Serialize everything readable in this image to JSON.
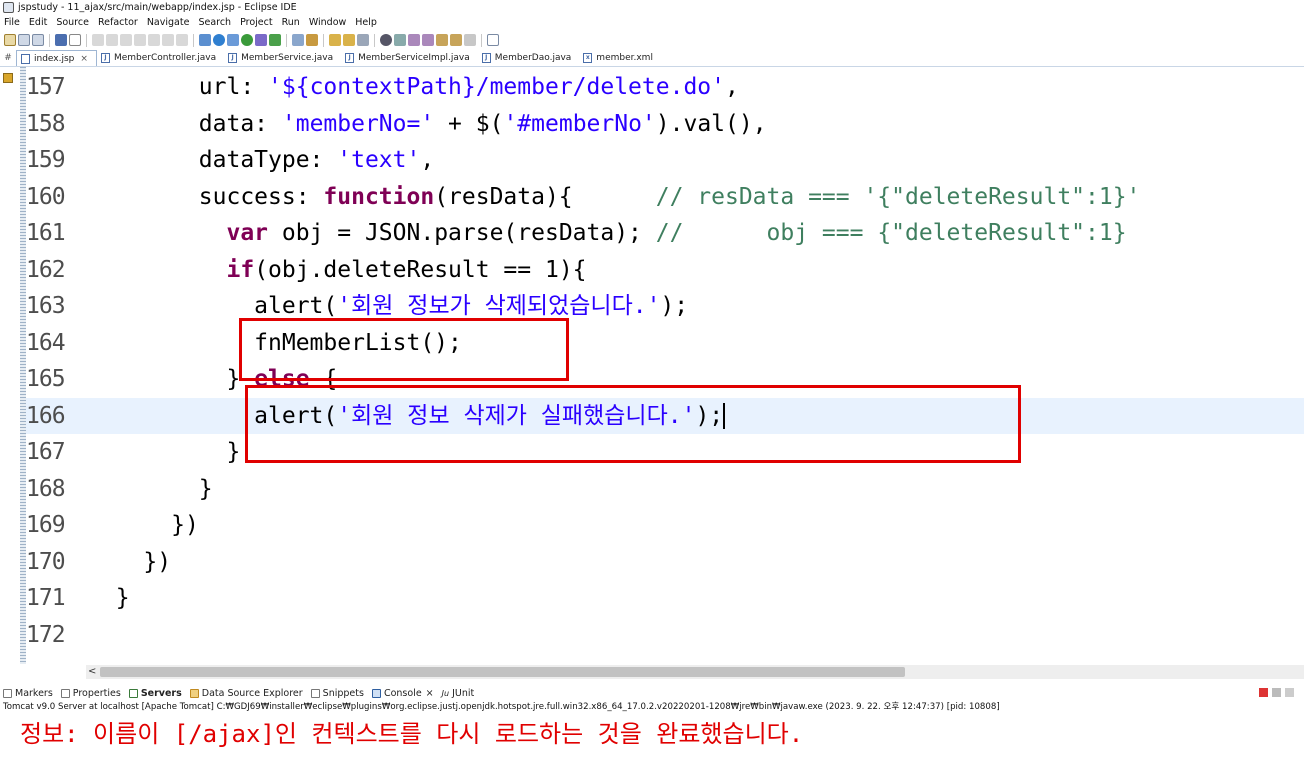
{
  "window": {
    "title": "jspstudy - 11_ajax/src/main/webapp/index.jsp - Eclipse IDE"
  },
  "menu": [
    "File",
    "Edit",
    "Source",
    "Refactor",
    "Navigate",
    "Search",
    "Project",
    "Run",
    "Window",
    "Help"
  ],
  "editor_tabs": [
    {
      "label": "index.jsp",
      "icon": "jsp-file-icon",
      "active": true,
      "close": "×"
    },
    {
      "label": "MemberController.java",
      "icon": "java-file-icon"
    },
    {
      "label": "MemberService.java",
      "icon": "java-file-icon"
    },
    {
      "label": "MemberServiceImpl.java",
      "icon": "java-file-icon"
    },
    {
      "label": "MemberDao.java",
      "icon": "java-file-icon"
    },
    {
      "label": "member.xml",
      "icon": "xml-file-icon"
    }
  ],
  "code": [
    {
      "n": "157",
      "indent": "        ",
      "tokens": [
        {
          "t": "url: "
        },
        {
          "t": "'${contextPath}/member/delete.do'",
          "c": "str"
        },
        {
          "t": ","
        }
      ]
    },
    {
      "n": "158",
      "indent": "        ",
      "tokens": [
        {
          "t": "data: "
        },
        {
          "t": "'memberNo='",
          "c": "str"
        },
        {
          "t": " + $("
        },
        {
          "t": "'#memberNo'",
          "c": "str"
        },
        {
          "t": ").val(),"
        }
      ]
    },
    {
      "n": "159",
      "indent": "        ",
      "tokens": [
        {
          "t": "dataType: "
        },
        {
          "t": "'text'",
          "c": "str"
        },
        {
          "t": ","
        }
      ]
    },
    {
      "n": "160",
      "indent": "        ",
      "tokens": [
        {
          "t": "success: "
        },
        {
          "t": "function",
          "c": "kw"
        },
        {
          "t": "(resData){      "
        },
        {
          "t": "// resData === '{\"deleteResult\":1}'",
          "c": "cm"
        }
      ]
    },
    {
      "n": "161",
      "indent": "          ",
      "tokens": [
        {
          "t": "var",
          "c": "kw"
        },
        {
          "t": " obj = JSON.parse(resData); "
        },
        {
          "t": "//      obj === {\"deleteResult\":1}",
          "c": "cm"
        }
      ]
    },
    {
      "n": "162",
      "indent": "          ",
      "tokens": [
        {
          "t": "if",
          "c": "kw"
        },
        {
          "t": "(obj.deleteResult == 1){"
        }
      ]
    },
    {
      "n": "163",
      "indent": "            ",
      "tokens": [
        {
          "t": "alert("
        },
        {
          "t": "'회원 정보가 삭제되었습니다.'",
          "c": "str"
        },
        {
          "t": ");"
        }
      ]
    },
    {
      "n": "164",
      "indent": "            ",
      "tokens": [
        {
          "t": "fnMemberList();"
        }
      ]
    },
    {
      "n": "165",
      "indent": "          ",
      "tokens": [
        {
          "t": "} "
        },
        {
          "t": "else",
          "c": "kw"
        },
        {
          "t": " {"
        }
      ]
    },
    {
      "n": "166",
      "indent": "            ",
      "tokens": [
        {
          "t": "alert("
        },
        {
          "t": "'회원 정보 삭제가 실패했습니다.'",
          "c": "str"
        },
        {
          "t": ");"
        }
      ],
      "current": true
    },
    {
      "n": "167",
      "indent": "          ",
      "tokens": [
        {
          "t": "}"
        }
      ]
    },
    {
      "n": "168",
      "indent": "        ",
      "tokens": [
        {
          "t": "}"
        }
      ]
    },
    {
      "n": "169",
      "indent": "      ",
      "tokens": [
        {
          "t": "})"
        }
      ]
    },
    {
      "n": "170",
      "indent": "    ",
      "tokens": [
        {
          "t": "})"
        }
      ]
    },
    {
      "n": "171",
      "indent": "  ",
      "tokens": [
        {
          "t": "}"
        }
      ]
    },
    {
      "n": "172",
      "indent": "",
      "tokens": []
    }
  ],
  "hscroll": {
    "arrow": "<"
  },
  "bottom_tabs": [
    {
      "label": "Markers"
    },
    {
      "label": "Properties"
    },
    {
      "label": "Servers",
      "bold": true
    },
    {
      "label": "Data Source Explorer"
    },
    {
      "label": "Snippets"
    },
    {
      "label": "Console",
      "close": "×"
    },
    {
      "label": "JUnit"
    }
  ],
  "console": {
    "info": "Tomcat v9.0 Server at localhost [Apache Tomcat] C:₩GDJ69₩installer₩eclipse₩plugins₩org.eclipse.justj.openjdk.hotspot.jre.full.win32.x86_64_17.0.2.v20220201-1208₩jre₩bin₩javaw.exe  (2023. 9. 22. 오후 12:47:37) [pid: 10808]",
    "output": "정보: 이름이 [/ajax]인 컨텍스트를 다시 로드하는 것을 완료했습니다."
  },
  "colors": {
    "annotation": "#e00000",
    "keyword": "#7f0055",
    "string": "#2a00ff",
    "comment": "#3f7f5f",
    "current_line": "#e8f2fe"
  }
}
